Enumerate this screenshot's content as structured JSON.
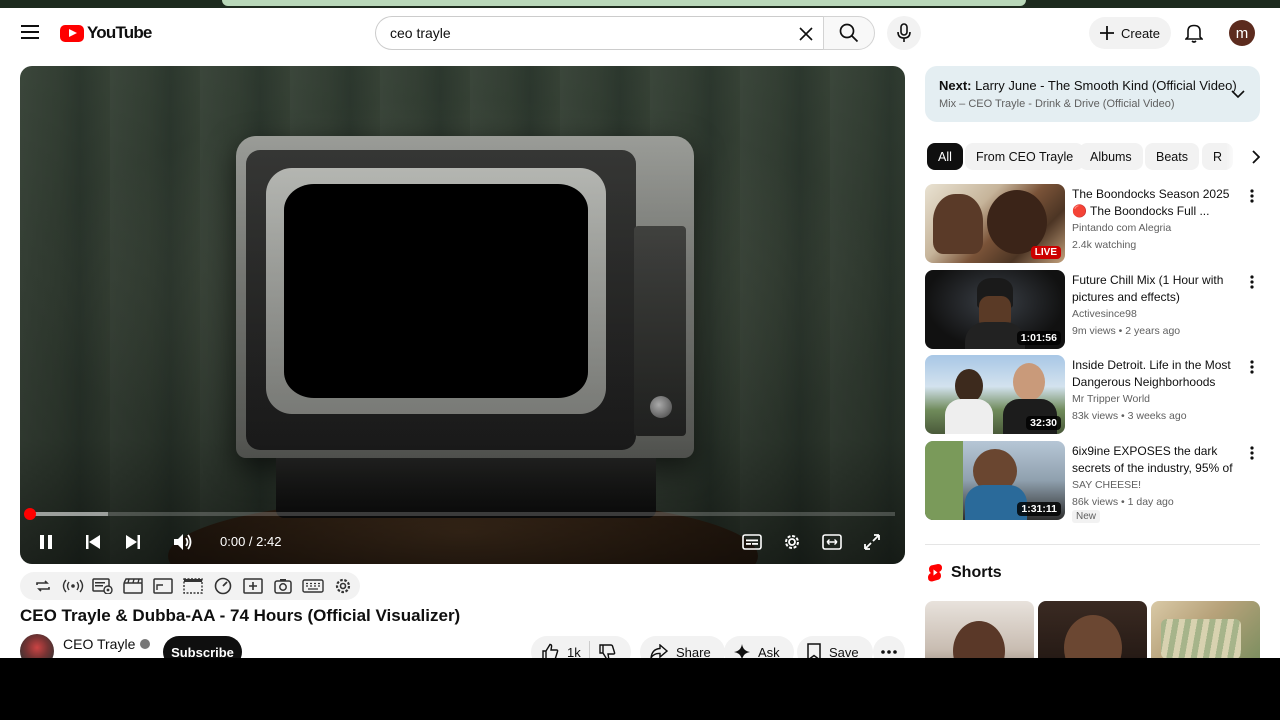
{
  "masthead": {
    "logo_text": "YouTube",
    "search_value": "ceo trayle",
    "create_label": "Create",
    "avatar_letter": "m"
  },
  "player": {
    "time": "0:00 / 2:42",
    "played_fraction": 0.0,
    "buffered_fraction": 0.09
  },
  "video": {
    "title": "CEO Trayle & Dubba-AA - 74 Hours (Official Visualizer)",
    "channel": "CEO Trayle",
    "subscribe_label": "Subscribe",
    "likes": "1k",
    "share_label": "Share",
    "ask_label": "Ask",
    "save_label": "Save"
  },
  "up_next": {
    "prefix": "Next:",
    "title": "Larry June - The Smooth Kind (Official Video)",
    "subtitle": "Mix – CEO Trayle - Drink & Drive (Official Video)"
  },
  "chips": [
    "All",
    "From CEO Trayle",
    "Albums",
    "Beats",
    "R"
  ],
  "recommendations": [
    {
      "title": "The Boondocks Season 2025 🔴 The Boondocks Full ...",
      "channel": "Pintando com Alegria",
      "meta": "2.4k watching",
      "badge": "",
      "duration": "LIVE"
    },
    {
      "title": "Future Chill Mix (1 Hour with pictures and effects)",
      "channel": "Activesince98",
      "meta": "9m views • 2 years ago",
      "badge": "",
      "duration": "1:01:56"
    },
    {
      "title": "Inside Detroit. Life in the Most Dangerous Neighborhoods",
      "channel": "Mr Tripper World",
      "meta": "83k views • 3 weeks ago",
      "badge": "",
      "duration": "32:30"
    },
    {
      "title": "6ix9ine EXPOSES the dark secrets of the industry, 95% of ...",
      "channel": "SAY CHEESE!",
      "meta": "86k views • 1 day ago",
      "badge": "New",
      "duration": "1:31:11"
    }
  ],
  "shorts": {
    "header": "Shorts"
  },
  "colors": {
    "brand_red": "#ff0000",
    "up_next_bg": "#e4eef2",
    "chip_active": "#0f0f0f"
  }
}
